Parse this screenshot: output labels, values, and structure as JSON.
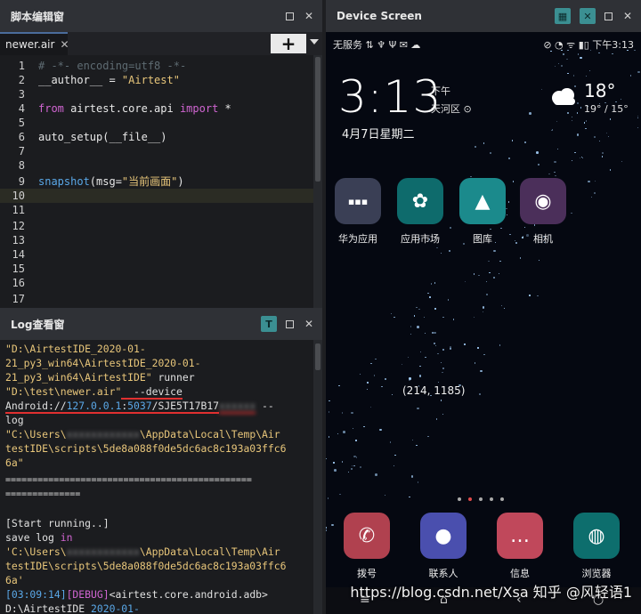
{
  "editor": {
    "title": "脚本编辑窗",
    "file_tab": "newer.air",
    "add_tab_symbol": "+",
    "lines": [
      {
        "n": "1"
      },
      {
        "n": "2"
      },
      {
        "n": "3"
      },
      {
        "n": "4"
      },
      {
        "n": "5"
      },
      {
        "n": "6"
      },
      {
        "n": "7"
      },
      {
        "n": "8"
      },
      {
        "n": "9"
      },
      {
        "n": "10"
      },
      {
        "n": "11"
      },
      {
        "n": "12"
      },
      {
        "n": "13"
      },
      {
        "n": "14"
      },
      {
        "n": "15"
      },
      {
        "n": "16"
      },
      {
        "n": "17"
      }
    ],
    "code": {
      "l1": "# -*- encoding=utf8 -*-",
      "l2a": "__author__ = ",
      "l2b": "\"Airtest\"",
      "l4a": "from",
      "l4b": " airtest.core.api ",
      "l4c": "import",
      "l4d": " *",
      "l6": "auto_setup(__file__)",
      "l9a": "snapshot",
      "l9b": "(msg=",
      "l9c": "\"当前画面\"",
      "l9d": ")"
    }
  },
  "log": {
    "title": "Log查看窗",
    "l1": "\"D:\\AirtestIDE_2020-01-",
    "l2": "21_py3_win64\\AirtestIDE_2020-01-",
    "l3a": "21_py3_win64\\AirtestIDE\"",
    "l3b": " runner",
    "l4a": "\"D:\\test\\newer.air\"",
    "l4b": "  --device",
    "l5a": "Android://",
    "l5b": "127.0.0.1",
    "l5c": ":",
    "l5d": "5037",
    "l5e": "/SJE5T17B17",
    "l5f": "xxxxxx",
    "l5g": " --",
    "l6": "log",
    "l7a": "\"C:\\Users\\",
    "l7b": "xxxxxxxxxxxx",
    "l7c": "\\AppData\\Local\\Temp\\Air",
    "l8": "testIDE\\scripts\\5de8a088f0de5dc6ac8c193a03ffc6",
    "l9": "6a\"",
    "l10": "==============================================",
    "l11": "==============",
    "l13": "[Start running..]",
    "l14a": "save log ",
    "l14b": "in",
    "l15a": "'C:\\Users\\",
    "l15b": "xxxxxxxxxxxx",
    "l15c": "\\AppData\\Local\\Temp\\Air",
    "l16": "testIDE\\scripts\\5de8a088f0de5dc6ac8c193a03ffc6",
    "l17": "6a'",
    "l18a": "[03:09:14]",
    "l18b": "[DEBUG]",
    "l18c": "<airtest.core.android.adb>",
    "l19a": "D:\\AirtestIDE_",
    "l19b": "2020-01-"
  },
  "device": {
    "title": "Device Screen",
    "status_left": "无服务 ⇅ ♆ Ψ ✉ ☁",
    "status_right": "⊘ ◔ ᯤ ▮▯ 下午3:13",
    "clock": "3:13",
    "ampm": "下午",
    "district": "天河区 ⊙",
    "date": "4月7日星期二",
    "temp": "18°",
    "temp_range": "19° / 15°",
    "apps_row1": [
      "华为应用",
      "应用市场",
      "图库",
      "相机"
    ],
    "apps_row2": [
      "拨号",
      "联系人",
      "信息",
      "浏览器"
    ],
    "coords": "(214, 1185)",
    "watermark": "https://blog.csdn.net/Xsa 知乎 @风轻语1"
  },
  "colors": {
    "panel_bg": "#27292d",
    "code_bg": "#1b1c1f",
    "keyword": "#d065d1",
    "string": "#e8c67a",
    "function": "#5aa8e8",
    "accent_red": "#e03030"
  }
}
